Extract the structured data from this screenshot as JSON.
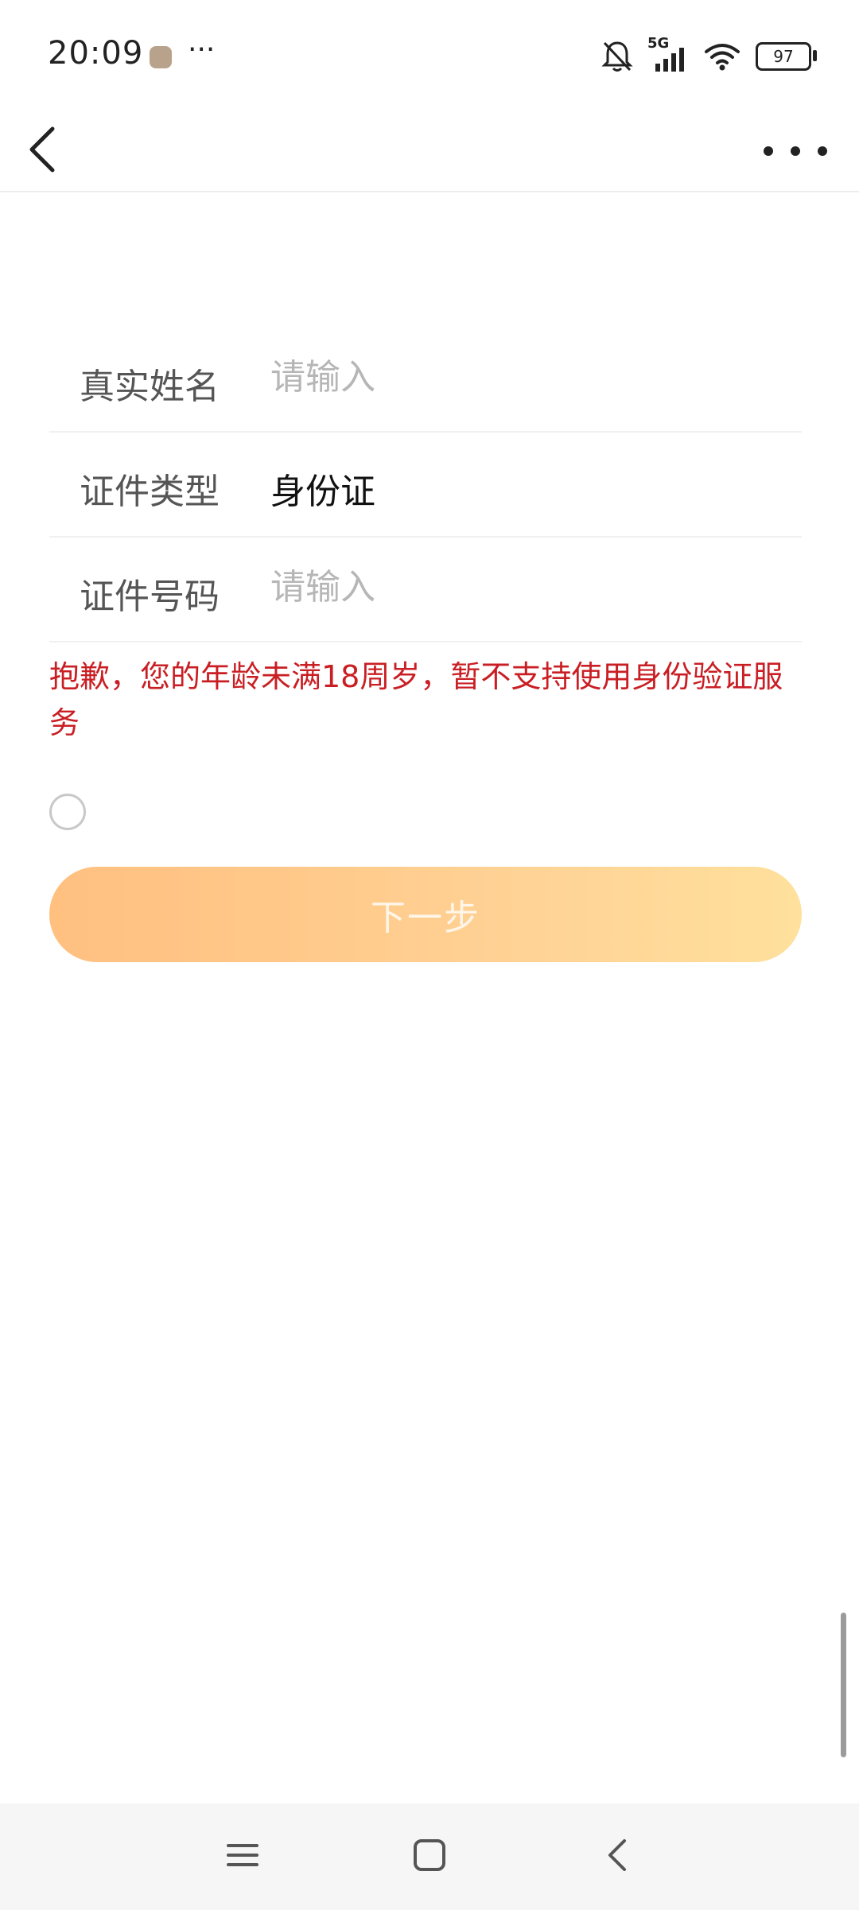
{
  "status_bar": {
    "time": "20:09",
    "more_indicator": "···",
    "network": "5G",
    "battery": "97"
  },
  "icons": {
    "back": "chevron-left-icon",
    "more": "ellipsis-icon",
    "nav_menu": "hamburger-icon",
    "nav_home": "square-icon",
    "nav_back": "chevron-left-icon"
  },
  "form": {
    "name": {
      "label": "真实姓名",
      "placeholder": "请输入",
      "value": ""
    },
    "id_type": {
      "label": "证件类型",
      "value": "身份证"
    },
    "id_number": {
      "label": "证件号码",
      "placeholder": "请输入",
      "value": ""
    }
  },
  "error_message": "抱歉，您的年龄未满18周岁，暂不支持使用身份验证服务",
  "agreement": {
    "checked": false
  },
  "next_button_label": "下一步",
  "colors": {
    "error": "#c91f24",
    "button_gradient_start": "#ffc080",
    "button_gradient_end": "#ffe09c",
    "label": "#555555",
    "placeholder": "#b6b6b6"
  }
}
